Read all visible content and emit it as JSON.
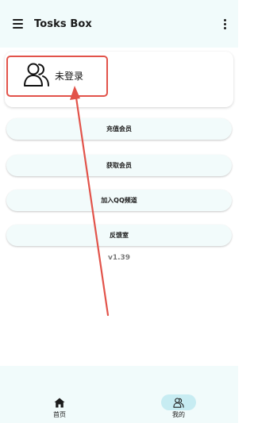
{
  "app": {
    "title": "Tosks Box"
  },
  "icons": {
    "menu": "hamburger-menu-icon",
    "more": "more-vert-icon",
    "avatar": "users-icon",
    "home": "home-icon",
    "mine": "people-icon"
  },
  "profile": {
    "name": "未登录"
  },
  "menu": {
    "items": [
      {
        "label": "充值会员"
      },
      {
        "label": "获取会员"
      },
      {
        "label": "加入QQ频道"
      },
      {
        "label": "反馈室"
      }
    ]
  },
  "version": "v1.39",
  "bottom_nav": {
    "items": [
      {
        "label": "首页",
        "selected": false
      },
      {
        "label": "我的",
        "selected": true
      }
    ]
  },
  "colors": {
    "appbar_bg": "#f1fbfb",
    "highlight_red": "#e2534a",
    "selected_pill": "#c7ecf2"
  }
}
